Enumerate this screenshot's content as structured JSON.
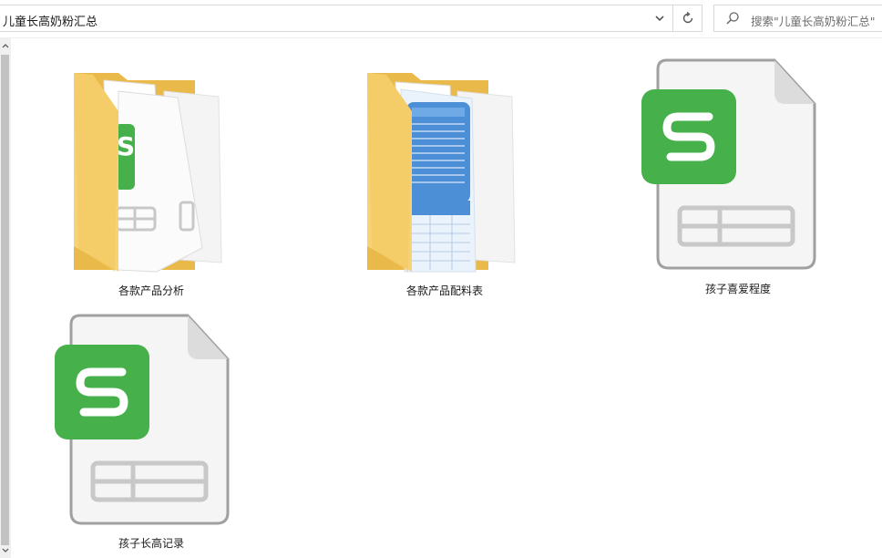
{
  "address_bar": {
    "path": "儿童长高奶粉汇总"
  },
  "search": {
    "placeholder": "搜索\"儿童长高奶粉汇总\""
  },
  "icons": {
    "dropdown": "chevron-down-icon",
    "refresh": "refresh-icon",
    "search": "search-icon",
    "scroll_up": "scroll-up-arrow-icon",
    "scroll_down": "scroll-down-arrow-icon"
  },
  "items": [
    {
      "name": "各款产品分析",
      "type": "folder",
      "preview": "spreadsheet"
    },
    {
      "name": "各款产品配料表",
      "type": "folder",
      "preview": "document-image"
    },
    {
      "name": "孩子喜爱程度",
      "type": "spreadsheet",
      "icon": "wps-spreadsheet-icon"
    },
    {
      "name": "孩子长高记录",
      "type": "spreadsheet",
      "icon": "wps-spreadsheet-icon"
    }
  ],
  "colors": {
    "folder": "#f5cf6a",
    "wps_green": "#46b14b",
    "selection_border": "#d9d9d9"
  }
}
